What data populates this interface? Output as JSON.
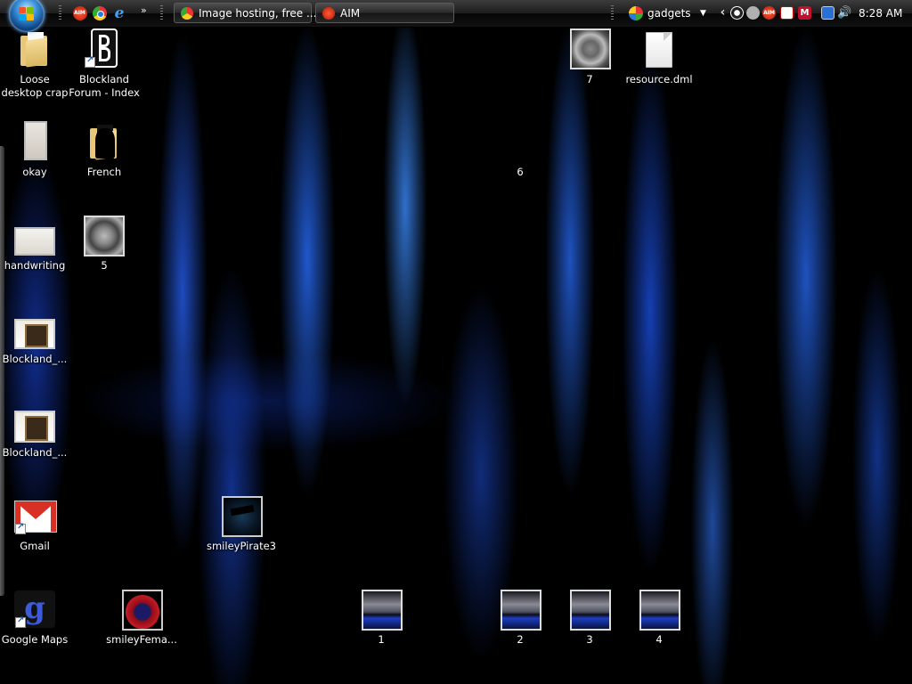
{
  "taskbar": {
    "quick_launch": [
      {
        "name": "aim-icon",
        "label": "AIM"
      },
      {
        "name": "chrome-icon"
      },
      {
        "name": "internet-explorer-icon",
        "glyph": "e"
      }
    ],
    "more_glyph": "»",
    "tasks": [
      {
        "label": "Image hosting, free ...",
        "icon": "chrome-icon"
      },
      {
        "label": "AIM",
        "icon": "aim-icon"
      }
    ],
    "gadgets_label": "gadgets",
    "gadgets_arrow": "▼",
    "tray_expand": "‹",
    "tray_aim_label": "AIM",
    "tray_m_label": "M",
    "clock": "8:28 AM"
  },
  "desktop": {
    "icons": {
      "loose": "Loose\ndesktop crap",
      "blockland_forum": "Blockland\nForum - Index",
      "okay": "okay",
      "french": "French",
      "handwriting": "handwriting",
      "five": "5",
      "blockland_1": "Blockland_...",
      "blockland_2": "Blockland_...",
      "gmail": "Gmail",
      "smiley_pirate": "smileyPirate3",
      "google_maps": "Google Maps",
      "smiley_female": "smileyFema...",
      "one": "1",
      "two": "2",
      "three": "3",
      "four": "4",
      "six": "6",
      "seven": "7",
      "resource": "resource.dml"
    }
  },
  "colors": {
    "wallpaper_blue": "#1e5cff",
    "taskbar": "#1a1a1a",
    "gmail_red": "#d93025"
  }
}
